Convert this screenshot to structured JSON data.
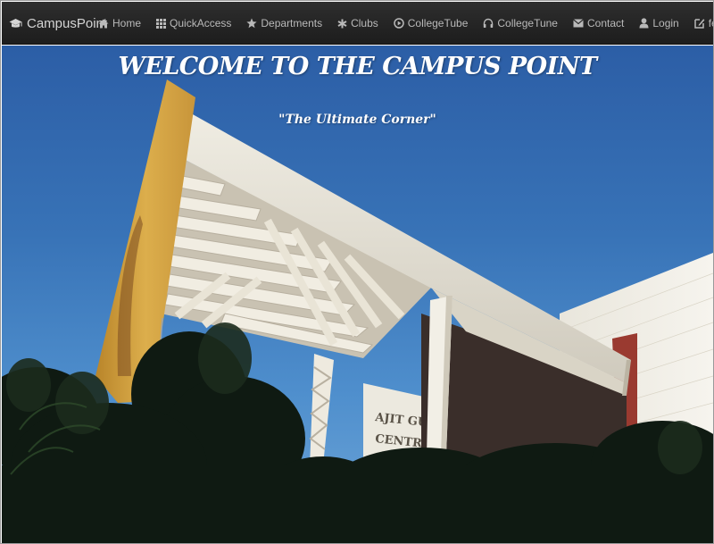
{
  "navbar": {
    "brand": {
      "label": "CampusPoint",
      "icon": "graduation-cap-icon"
    },
    "items": [
      {
        "label": "Home",
        "icon": "home-icon"
      },
      {
        "label": "QuickAccess",
        "icon": "grid-icon"
      },
      {
        "label": "Departments",
        "icon": "star-icon"
      },
      {
        "label": "Clubs",
        "icon": "asterisk-icon"
      },
      {
        "label": "CollegeTube",
        "icon": "play-circle-icon"
      },
      {
        "label": "CollegeTune",
        "icon": "headphones-icon"
      },
      {
        "label": "Contact",
        "icon": "envelope-icon"
      },
      {
        "label": "Login",
        "icon": "user-icon"
      },
      {
        "label": "feedback",
        "icon": "edit-icon"
      }
    ]
  },
  "hero": {
    "title": "WELCOME TO THE CAMPUS POINT",
    "subtitle": "\"The Ultimate Corner\"",
    "building_sign": "AJIT GULABCH CENTRAL LIBR"
  },
  "colors": {
    "navbar_bg": "#222222",
    "nav_text": "#b9b9b9",
    "sky": "#3873b7",
    "concrete": "#e8e4d8",
    "ochre": "#d4a340",
    "brick": "#9a3a30"
  }
}
